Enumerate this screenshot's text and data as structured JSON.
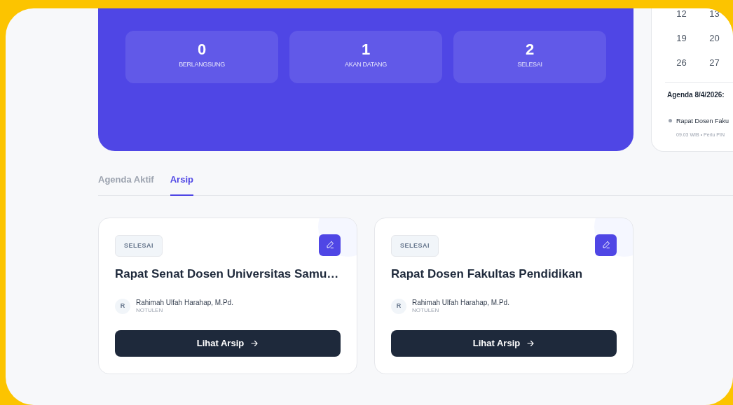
{
  "stats": [
    {
      "value": "0",
      "label": "BERLANGSUNG"
    },
    {
      "value": "1",
      "label": "AKAN DATANG"
    },
    {
      "value": "2",
      "label": "SELESAI"
    }
  ],
  "calendar": {
    "weeks": [
      [
        "12",
        "13"
      ],
      [
        "19",
        "20"
      ],
      [
        "26",
        "27"
      ]
    ],
    "agenda_title": "Agenda 8/4/2026:",
    "agenda": [
      {
        "title": "Rapat Dosen Faku",
        "meta": "09.03 WIB • Perlu PIN"
      }
    ]
  },
  "tabs": [
    {
      "label": "Agenda Aktif",
      "selected": false
    },
    {
      "label": "Arsip",
      "selected": true
    }
  ],
  "cards": [
    {
      "status": "SELESAI",
      "title": "Rapat Senat Dosen Universitas Samu…",
      "avatar": "R",
      "person": "Rahimah Ulfah Harahap, M.Pd.",
      "role": "NOTULEN",
      "button": "Lihat Arsip"
    },
    {
      "status": "SELESAI",
      "title": "Rapat Dosen Fakultas Pendidikan",
      "avatar": "R",
      "person": "Rahimah Ulfah Harahap, M.Pd.",
      "role": "NOTULEN",
      "button": "Lihat Arsip"
    }
  ]
}
